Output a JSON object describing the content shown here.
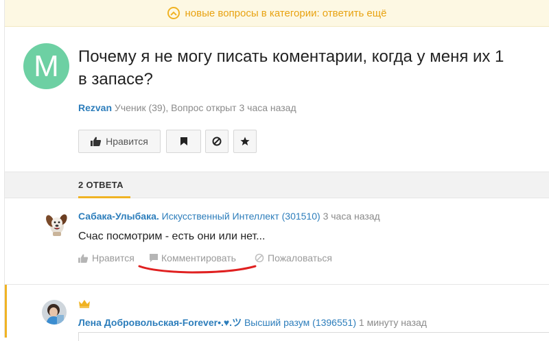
{
  "banner": {
    "text": "новые вопросы в категории: ответить ещё"
  },
  "question": {
    "avatar_letter": "M",
    "title_line1": "Почему я не могу писать коментарии, когда у меня их 1",
    "title_line2": "в запасе?",
    "author": "Rezvan",
    "meta": "Ученик (39), Вопрос открыт 3 часа назад",
    "like_label": "Нравится"
  },
  "answers_header": {
    "label": "2 ОТВЕТА"
  },
  "answers": [
    {
      "author": "Сабака-Улыбака.",
      "rank": "Искусственный Интеллект (301510)",
      "time": "3 часа назад",
      "text": "Счас посмотрим - есть они или нет...",
      "like_label": "Нравится",
      "comment_label": "Комментировать",
      "report_label": "Пожаловаться"
    },
    {
      "author": "Лена Добровольская-Forever•.♥.ツ",
      "rank": "Высший разум (1396551)",
      "time": "1 минуту назад"
    }
  ],
  "colors": {
    "accent": "#f0b323",
    "link": "#2c7dbb",
    "avatar": "#6dd0a3",
    "annotation": "#e02020"
  }
}
